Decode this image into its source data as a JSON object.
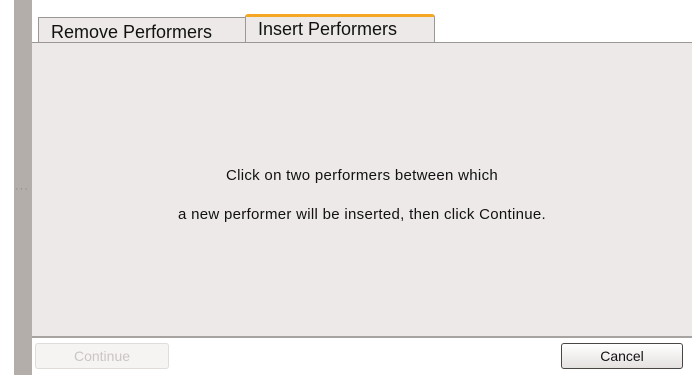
{
  "tabs": [
    {
      "label": "Remove Performers",
      "active": false
    },
    {
      "label": "Insert Performers",
      "active": true
    }
  ],
  "panel": {
    "message_line1": "Click on two performers between which",
    "message_line2": "a new performer will be inserted, then click Continue."
  },
  "footer": {
    "continue_label": "Continue",
    "continue_enabled": false,
    "cancel_label": "Cancel"
  },
  "colors": {
    "active_tab_accent": "#f5a623",
    "panel_background": "#ece9e8",
    "splitter": "#b3aeaa"
  },
  "icons": {
    "splitter_grip": "grip-dots-icon"
  }
}
